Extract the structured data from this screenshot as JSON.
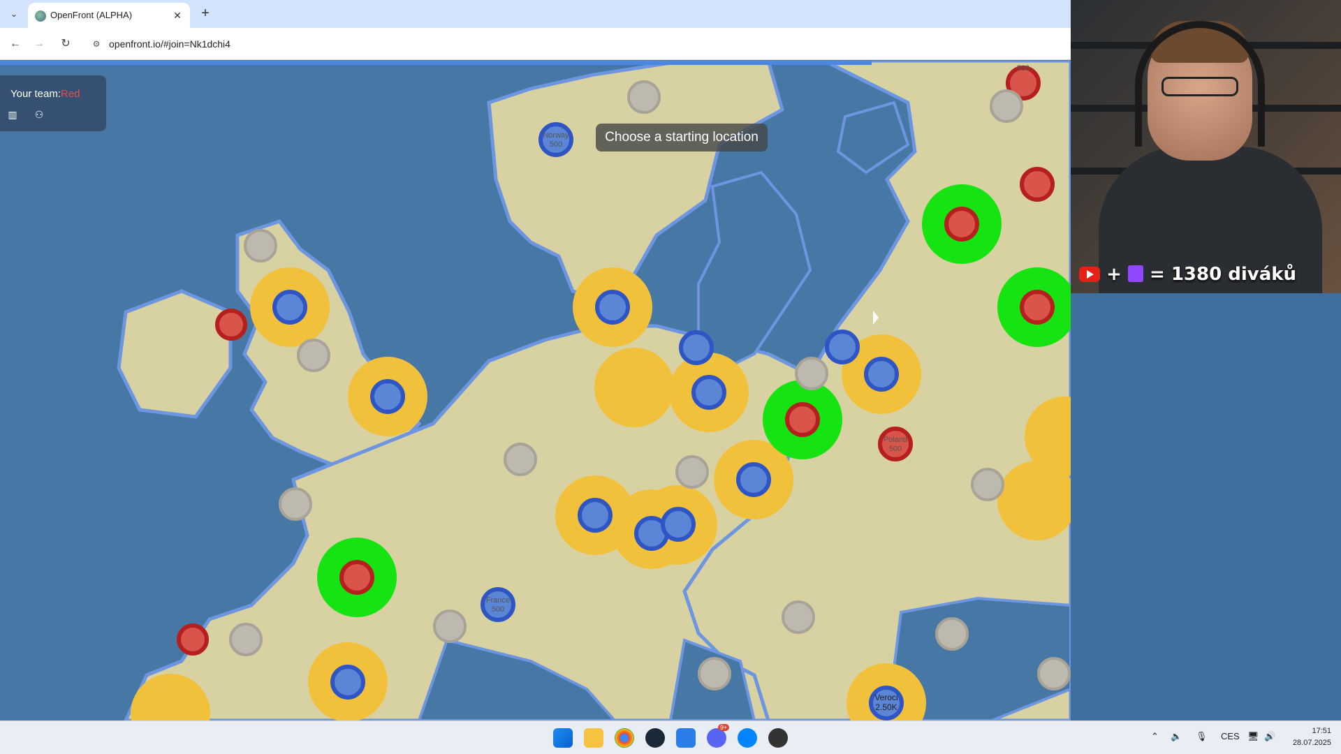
{
  "browser": {
    "tab_title": "OpenFront (ALPHA)",
    "url": "openfront.io/#join=Nk1dchi4"
  },
  "game": {
    "team_label": "Your team:",
    "team_name": "Red",
    "toast": "Choose a starting location",
    "nations": [
      {
        "name": "Norway",
        "troops": "500"
      },
      {
        "name": "Poland",
        "troops": "500"
      },
      {
        "name": "France",
        "troops": "500"
      },
      {
        "name": "Veroci",
        "troops": "2.50K"
      },
      {
        "name": "",
        "troops": "500"
      }
    ]
  },
  "stream": {
    "viewer_text": "= 1380 diváků",
    "plus": "+"
  },
  "taskbar": {
    "lang": "CES",
    "time": "17:51",
    "date": "28.07.2025",
    "discord_badge": "9+"
  },
  "colors": {
    "ocean": "#4677a5",
    "land": "#d9d3a1",
    "team_red": "#d9544a",
    "team_blue": "#4a78cc",
    "highlight_yellow": "#f2c13c",
    "highlight_green": "#16e312",
    "neutral": "#bdb9ae"
  }
}
